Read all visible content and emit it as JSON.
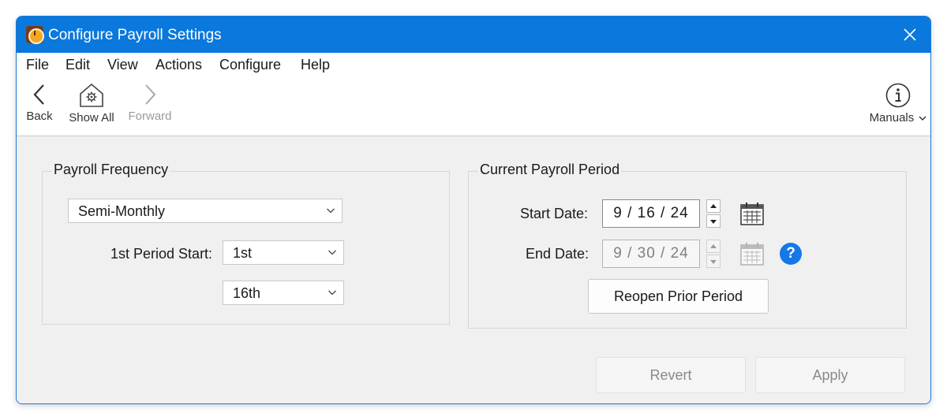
{
  "window": {
    "title": "Configure Payroll Settings"
  },
  "menu": {
    "items": [
      "File",
      "Edit",
      "View",
      "Actions",
      "Configure",
      "Help"
    ]
  },
  "toolbar": {
    "back_label": "Back",
    "show_all_label": "Show All",
    "forward_label": "Forward",
    "manuals_label": "Manuals"
  },
  "payroll_frequency": {
    "title": "Payroll Frequency",
    "frequency_value": "Semi-Monthly",
    "first_period_start_label": "1st Period Start:",
    "first_period_start_value": "1st",
    "second_period_start_value": "16th"
  },
  "current_period": {
    "title": "Current Payroll Period",
    "start_date_label": "Start Date:",
    "start_date_value": "9 / 16 / 24",
    "end_date_label": "End Date:",
    "end_date_value": "9 / 30 / 24",
    "help_glyph": "?",
    "reopen_label": "Reopen Prior Period"
  },
  "actions": {
    "revert_label": "Revert",
    "apply_label": "Apply"
  },
  "colors": {
    "titlebar": "#0a78dc",
    "help": "#1479e6",
    "window_bg": "#f0f0f0"
  }
}
